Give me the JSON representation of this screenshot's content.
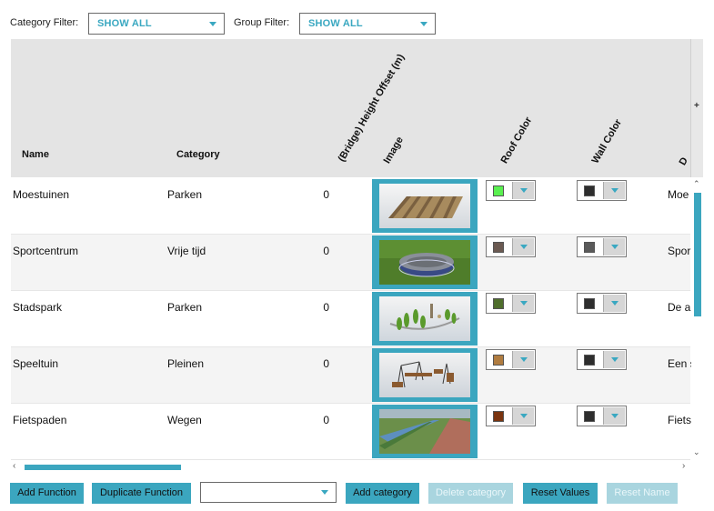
{
  "filters": {
    "category_label": "Category Filter:",
    "category_value": "SHOW ALL",
    "group_label": "Group Filter:",
    "group_value": "SHOW ALL"
  },
  "table": {
    "columns": {
      "name": "Name",
      "category": "Category",
      "height_offset": "(Bridge) Height Offset  (m)",
      "image": "Image",
      "roof_color": "Roof Color",
      "wall_color": "Wall Color",
      "description_partial": "D"
    },
    "rows": [
      {
        "name": "Moestuinen",
        "category": "Parken",
        "height_offset": "0",
        "roof_color": "#5af050",
        "wall_color": "#2e2e2e",
        "description": "Moe"
      },
      {
        "name": "Sportcentrum",
        "category": "Vrije tijd",
        "height_offset": "0",
        "roof_color": "#6b5a52",
        "wall_color": "#5a5a5a",
        "description": "Spor"
      },
      {
        "name": "Stadspark",
        "category": "Parken",
        "height_offset": "0",
        "roof_color": "#4f6e2c",
        "wall_color": "#2e2e2e",
        "description": "De a"
      },
      {
        "name": "Speeltuin",
        "category": "Pleinen",
        "height_offset": "0",
        "roof_color": "#b07c40",
        "wall_color": "#2e2e2e",
        "description": "Een s"
      },
      {
        "name": "Fietspaden",
        "category": "Wegen",
        "height_offset": "0",
        "roof_color": "#7a3410",
        "wall_color": "#2e2e2e",
        "description": "Fiets"
      }
    ]
  },
  "buttons": {
    "add_function": "Add Function",
    "duplicate_function": "Duplicate Function",
    "add_category": "Add category",
    "delete_category": "Delete category",
    "reset_values": "Reset Values",
    "reset_name": "Reset Name"
  },
  "colors": {
    "accent": "#3ba6bf",
    "header_bg": "#e4e4e4"
  }
}
